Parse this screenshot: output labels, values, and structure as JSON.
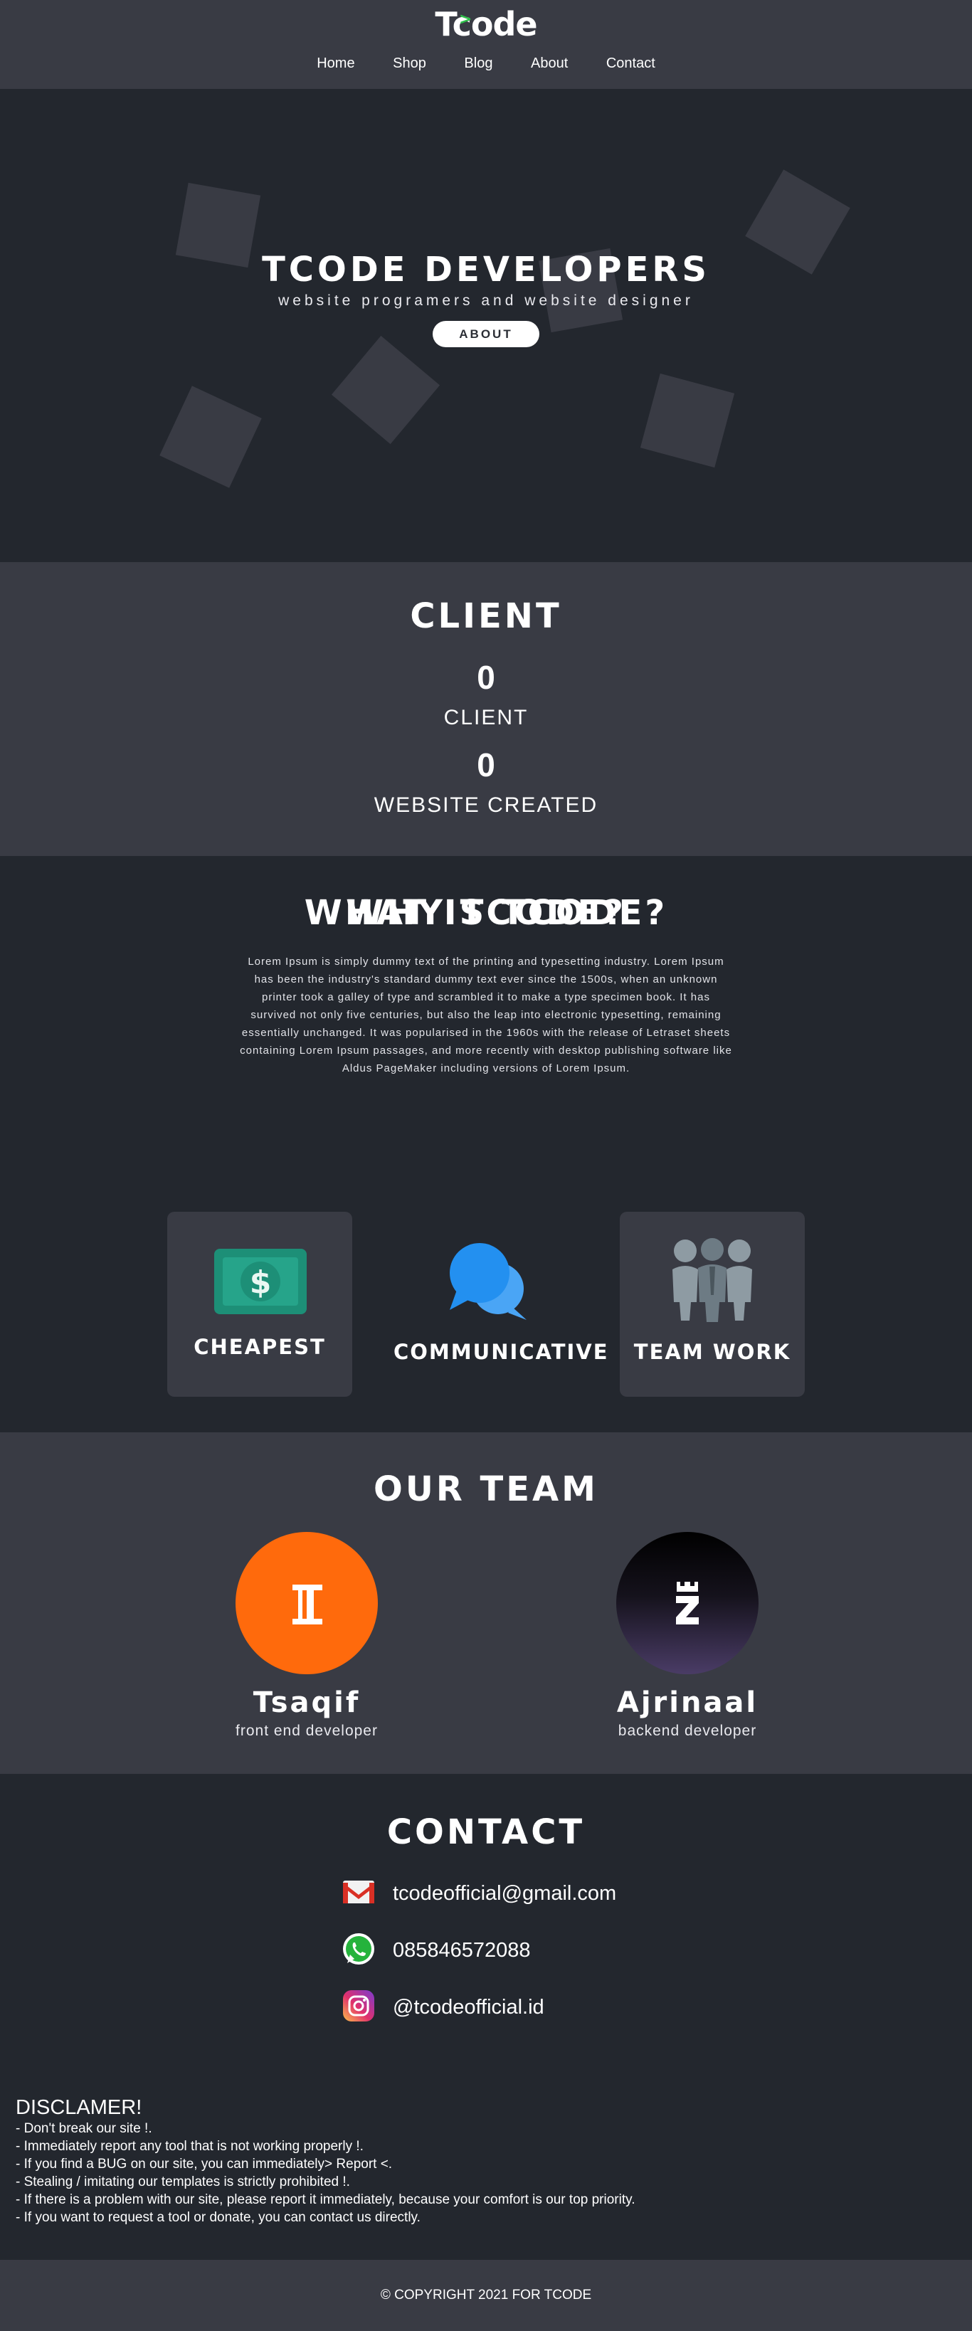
{
  "header": {
    "logo": "Tcode",
    "nav": [
      "Home",
      "Shop",
      "Blog",
      "About",
      "Contact"
    ]
  },
  "hero": {
    "title": "TCODE DEVELOPERS",
    "subtitle": "website programers and website designer",
    "button": "ABOUT"
  },
  "client": {
    "title": "CLIENT",
    "stats": [
      {
        "value": "0",
        "label": "CLIENT"
      },
      {
        "value": "0",
        "label": "WEBSITE CREATED"
      }
    ]
  },
  "what": {
    "title": "WHAT IS TCODE?",
    "text": "Lorem Ipsum is simply dummy text of the printing and typesetting industry. Lorem Ipsum has been the industry's standard dummy text ever since the 1500s, when an unknown printer took a galley of type and scrambled it to make a type specimen book. It has survived not only five centuries, but also the leap into electronic typesetting, remaining essentially unchanged. It was popularised in the 1960s with the release of Letraset sheets containing Lorem Ipsum passages, and more recently with desktop publishing software like Aldus PageMaker including versions of Lorem Ipsum."
  },
  "why": {
    "title": "WHY TCODE?",
    "cards": [
      {
        "label": "CHEAPEST",
        "icon": "money-icon"
      },
      {
        "label": "COMMUNICATIVE",
        "icon": "chat-bubbles-icon"
      },
      {
        "label": "TEAM WORK",
        "icon": "team-people-icon"
      }
    ]
  },
  "team": {
    "title": "OUR TEAM",
    "members": [
      {
        "name": "Tsaqif",
        "role": "front end developer"
      },
      {
        "name": "Ajrinaal",
        "role": "backend developer"
      }
    ]
  },
  "contact": {
    "title": "CONTACT",
    "items": [
      {
        "icon": "gmail-icon",
        "text": "tcodeofficial@gmail.com"
      },
      {
        "icon": "whatsapp-icon",
        "text": "085846572088"
      },
      {
        "icon": "instagram-icon",
        "text": "@tcodeofficial.id"
      }
    ]
  },
  "disclaimer": {
    "title": "DISCLAMER!",
    "lines": [
      "- Don't break our site !.",
      "- Immediately report any tool that is not working properly !.",
      "- If you find a BUG on our site, you can immediately> Report <.",
      "- Stealing / imitating our templates is strictly prohibited !.",
      "- If there is a problem with our site, please report it immediately, because your comfort is our top priority.",
      "- If you want to request a tool or donate, you can contact us directly."
    ]
  },
  "footer": {
    "copyright": "© COPYRIGHT 2021 FOR TCODE"
  },
  "colors": {
    "dark_bg": "#23272e",
    "panel_bg": "#393b44",
    "accent_green": "#2ec04a",
    "avatar_orange": "#ff6a0c"
  }
}
